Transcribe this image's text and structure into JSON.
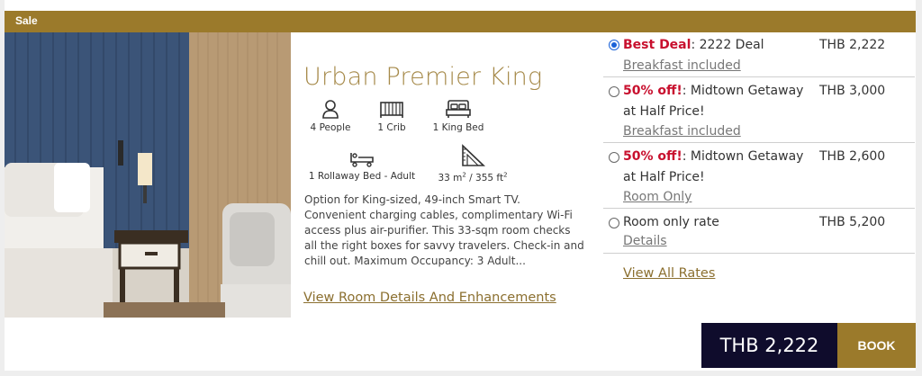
{
  "banner": {
    "label": "Sale"
  },
  "room": {
    "title": "Urban Premier King",
    "amenities": [
      {
        "icon": "person-icon",
        "label": "4 People"
      },
      {
        "icon": "crib-icon",
        "label": "1 Crib"
      },
      {
        "icon": "king-bed-icon",
        "label": "1 King Bed"
      },
      {
        "icon": "rollaway-bed-icon",
        "label": "1 Rollaway Bed - Adult"
      },
      {
        "icon": "room-size-icon",
        "label_prefix": "33 m",
        "sup1": "2",
        "label_mid": " / 355 ft",
        "sup2": "2"
      }
    ],
    "description": "Option for King-sized, 49-inch Smart TV. Convenient charging cables, complimentary Wi-Fi access plus air-purifier. This 33-sqm room checks all the right boxes for savvy travelers. Check-in and chill out. Maximum Occupancy: 3 Adult...",
    "details_link": "View Room Details And Enhancements"
  },
  "rates": [
    {
      "selected": true,
      "tag": "Best Deal",
      "name_rest": ": 2222 Deal",
      "price": "THB 2,222",
      "sub": "Breakfast included"
    },
    {
      "selected": false,
      "tag": "50% off!",
      "name_rest": ": Midtown Getaway at Half Price!",
      "price": "THB 3,000",
      "sub": "Breakfast included"
    },
    {
      "selected": false,
      "tag": "50% off!",
      "name_rest": ": Midtown Getaway at Half Price!",
      "price": "THB 2,600",
      "sub": "Room Only"
    },
    {
      "selected": false,
      "tag": "",
      "name_rest": "Room only rate",
      "price": "THB 5,200",
      "sub": "Details"
    }
  ],
  "view_all_rates": "View All Rates",
  "footer": {
    "total": "THB 2,222",
    "book_label": "BOOK"
  },
  "colors": {
    "gold": "#9b7a2b",
    "navy": "#0f0c2c",
    "deal_red": "#c8102e",
    "radio_blue": "#1a62d8"
  }
}
